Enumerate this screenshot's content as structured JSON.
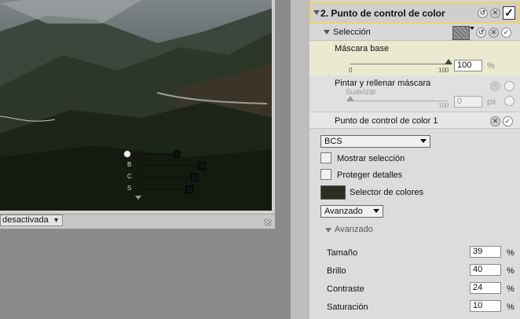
{
  "viewer": {
    "status_dropdown": "desactivada",
    "control_point_letters": [
      "B",
      "C",
      "S"
    ]
  },
  "panel": {
    "header": {
      "title": "2. Punto de control de color"
    },
    "selection": {
      "label": "Selección"
    },
    "mask_base": {
      "label": "Máscara base",
      "tick_min": "0",
      "tick_max": "100",
      "value": "100",
      "unit": "%"
    },
    "paint_mask": {
      "label": "Pintar y rellenar máscara",
      "sublabel": "Suavizar",
      "tick_min": "0",
      "tick_max": "100",
      "value": "0",
      "unit": "px"
    },
    "cp1": {
      "title": "Punto de control de color 1",
      "mode_dropdown": "BCS",
      "show_selection": "Mostrar selección",
      "protect_details": "Proteger detalles",
      "color_picker": "Selector de colores",
      "advanced_dropdown": "Avanzado",
      "advanced_section": "Avanzado",
      "swatch_color": "#2a2f22",
      "params": [
        {
          "label": "Tamaño",
          "value": "39",
          "unit": "%"
        },
        {
          "label": "Brillo",
          "value": "40",
          "unit": "%"
        },
        {
          "label": "Contraste",
          "value": "24",
          "unit": "%"
        },
        {
          "label": "Saturación",
          "value": "10",
          "unit": "%"
        }
      ]
    }
  },
  "colors": {
    "header_border": "#f2d36a",
    "panel_bg": "#d6d6d6",
    "mask_section_bg": "#ebe9cf"
  }
}
